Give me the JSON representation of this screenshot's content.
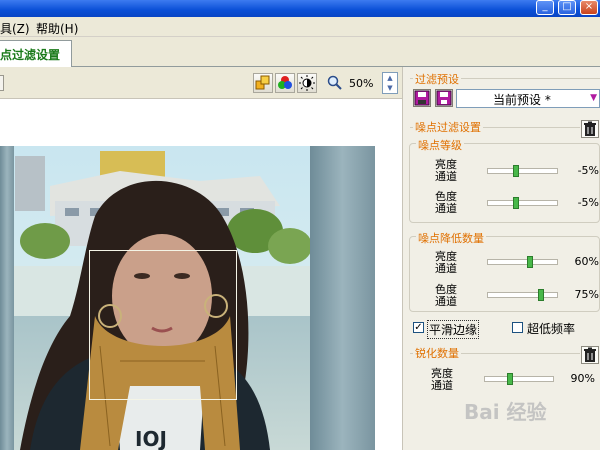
{
  "window": {
    "minimize": "_",
    "maximize": "□",
    "close": "×"
  },
  "menu": {
    "items": [
      "具(Z)",
      "帮助(H)"
    ]
  },
  "tab": {
    "label": "点过滤设置"
  },
  "toolbar": {
    "zoom": "50%"
  },
  "panel": {
    "preset": {
      "title": "过滤预设",
      "selected": "当前预设 *"
    },
    "noise_filter": {
      "title": "噪点过滤设置"
    },
    "noise_level": {
      "title": "噪点等级",
      "rows": [
        {
          "label1": "亮度",
          "label2": "通道",
          "value": "-5%",
          "level": 0.4
        },
        {
          "label1": "色度",
          "label2": "通道",
          "value": "-5%",
          "level": 0.4
        }
      ]
    },
    "noise_reduction": {
      "title": "噪点降低数量",
      "rows": [
        {
          "label1": "亮度",
          "label2": "通道",
          "value": "60%",
          "level": 0.6
        },
        {
          "label1": "色度",
          "label2": "通道",
          "value": "75%",
          "level": 0.75
        }
      ]
    },
    "options": {
      "smooth_edges": {
        "label": "平滑边缘",
        "checked": true
      },
      "ultra_low_freq": {
        "label": "超低频率",
        "checked": false
      }
    },
    "sharpen": {
      "title": "锐化数量",
      "rows": [
        {
          "label1": "亮度",
          "label2": "通道",
          "value": "90%",
          "level": 0.35
        }
      ]
    }
  },
  "watermark": "Bai 经验"
}
